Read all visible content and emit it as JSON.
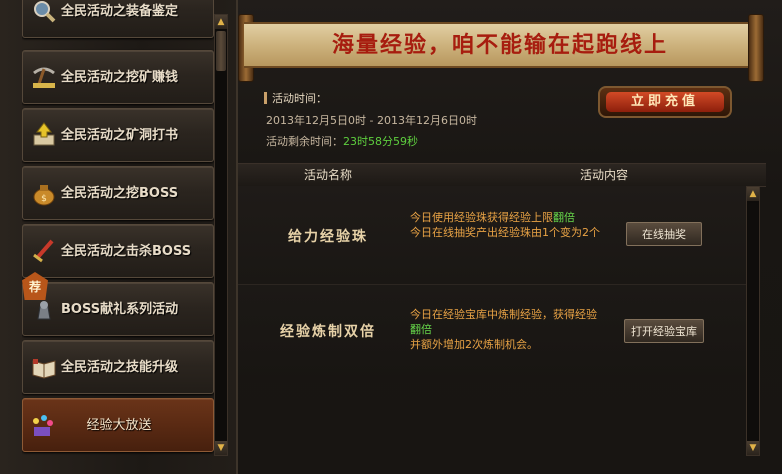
{
  "sidebar": {
    "items": [
      {
        "label": "全民活动之装备鉴定",
        "icon": "magnifier-icon"
      },
      {
        "label": "全民活动之挖矿赚钱",
        "icon": "pickaxe-icon"
      },
      {
        "label": "全民活动之矿洞打书",
        "icon": "book-arrow-icon"
      },
      {
        "label": "全民活动之挖BOSS",
        "icon": "money-bag-icon"
      },
      {
        "label": "全民活动之击杀BOSS",
        "icon": "sword-icon"
      },
      {
        "label": "BOSS献礼系列活动",
        "icon": "armored-knight-icon"
      },
      {
        "label": "全民活动之技能升级",
        "icon": "open-book-icon"
      },
      {
        "label": "经验大放送",
        "icon": "gift-sparkle-icon"
      }
    ],
    "recommend_tag": "荐"
  },
  "banner": {
    "title": "海量经验，咱不能输在起跑线上"
  },
  "event_info": {
    "time_label": "活动时间：",
    "time_range": "2013年12月5日0时 - 2013年12月6日0时",
    "remaining_label": "活动剩余时间：",
    "remaining_value": "23时58分59秒"
  },
  "claim_button": {
    "label": "立即充值"
  },
  "table": {
    "headers": {
      "name": "活动名称",
      "content": "活动内容"
    },
    "rows": [
      {
        "name": "给力经验珠",
        "desc_line1_a": "今日使用经验珠获得经验上限",
        "desc_line1_b": "翻倍",
        "desc_line2": "今日在线抽奖产出经验珠由1个变为2个",
        "button": "在线抽奖"
      },
      {
        "name": "经验炼制双倍",
        "desc_line1": "今日在经验宝库中炼制经验，获得经验",
        "desc_line2": "翻倍",
        "desc_line3": "并额外增加2次炼制机会。",
        "button": "打开经验宝库"
      }
    ]
  }
}
